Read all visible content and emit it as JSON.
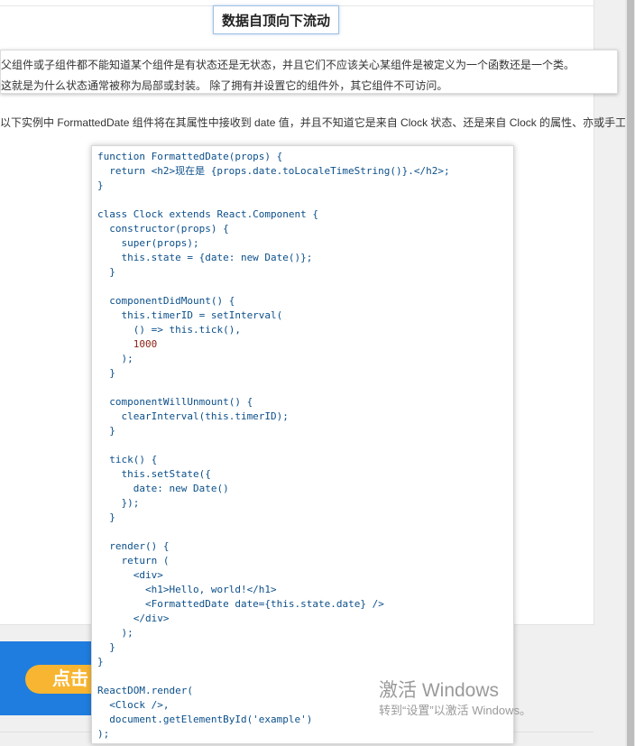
{
  "heading": "数据自顶向下流动",
  "notes": {
    "line1": "父组件或子组件都不能知道某个组件是有状态还是无状态，并且它们不应该关心某组件是被定义为一个函数还是一个类。",
    "line2": "这就是为什么状态通常被称为局部或封装。 除了拥有并设置它的组件外，其它组件不可访问。",
    "line3": "以下实例中 FormattedDate 组件将在其属性中接收到 date 值，并且不知道它是来自 Clock 状态、还是来自 Clock 的属性、亦或手工输入："
  },
  "code_lines": [
    "function FormattedDate(props) {",
    "  return <h2>现在是 {props.date.toLocaleTimeString()}.</h2>;",
    "}",
    "",
    "class Clock extends React.Component {",
    "  constructor(props) {",
    "    super(props);",
    "    this.state = {date: new Date()};",
    "  }",
    "",
    "  componentDidMount() {",
    "    this.timerID = setInterval(",
    "      () => this.tick(),",
    "      1000",
    "    );",
    "  }",
    "",
    "  componentWillUnmount() {",
    "    clearInterval(this.timerID);",
    "  }",
    "",
    "  tick() {",
    "    this.setState({",
    "      date: new Date()",
    "    });",
    "  }",
    "",
    "  render() {",
    "    return (",
    "      <div>",
    "        <h1>Hello, world!</h1>",
    "        <FormattedDate date={this.state.date} />",
    "      </div>",
    "    );",
    "  }",
    "}",
    "",
    "ReactDOM.render(",
    "  <Clock />,",
    "  document.getElementById('example')",
    ");"
  ],
  "promo": {
    "button_label": "点击"
  },
  "watermark": {
    "title": "激活 Windows",
    "subtitle": "转到“设置”以激活 Windows。"
  }
}
